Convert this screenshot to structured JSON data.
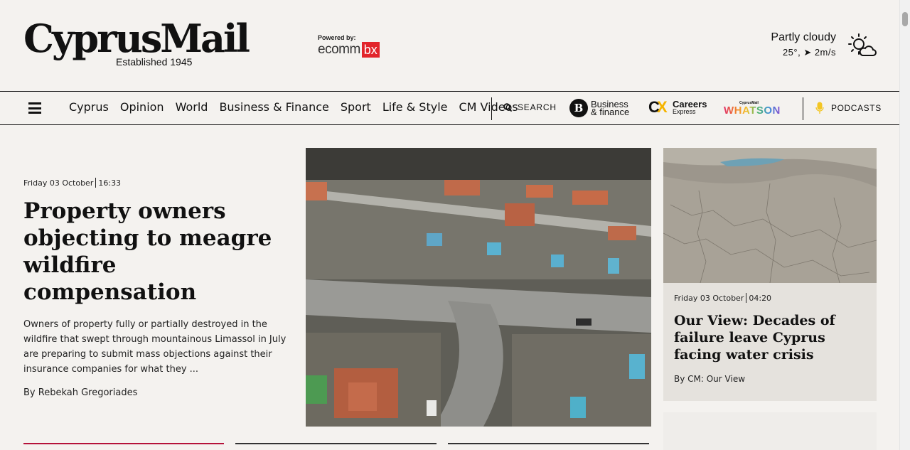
{
  "brand": {
    "logo": "CyprusMail",
    "established": "Established 1945",
    "powered_by_label": "Powered by:",
    "powered_by_part1": "ecomm",
    "powered_by_part2": "bx"
  },
  "weather": {
    "condition": "Partly cloudy",
    "details": "25°, ➤ 2m/s",
    "icon": "sun-cloud-icon"
  },
  "nav": {
    "links": [
      "Cyprus",
      "Opinion",
      "World",
      "Business & Finance",
      "Sport",
      "Life & Style",
      "CM Videos"
    ],
    "search_label": "SEARCH",
    "partners": {
      "business_badge": "B",
      "business_line1": "Business",
      "business_line2": "& finance",
      "careers_line1": "Careers",
      "careers_line2": "Express",
      "whatson_small": "CyprusMail",
      "whatson_big": "WHATSON"
    },
    "podcasts_label": "PODCASTS"
  },
  "lead_story": {
    "date": "Friday 03 October",
    "time": "16:33",
    "title": "Property owners objecting to meagre wildfire compensation",
    "summary": "Owners of property fully or partially destroyed in the wildfire that swept through mountainous Limassol in July are preparing to submit mass objections against their insurance companies for what they ...",
    "byline": "By Rebekah Gregoriades"
  },
  "side_story": {
    "date": "Friday 03 October",
    "time": "04:20",
    "title": "Our View: Decades of failure leave Cyprus facing water crisis",
    "byline": "By CM: Our View"
  },
  "colors": {
    "background": "#f4f2ef",
    "accent_red": "#b5123a",
    "ecommbx_red": "#e2252b",
    "careers_yellow": "#f5b400"
  }
}
